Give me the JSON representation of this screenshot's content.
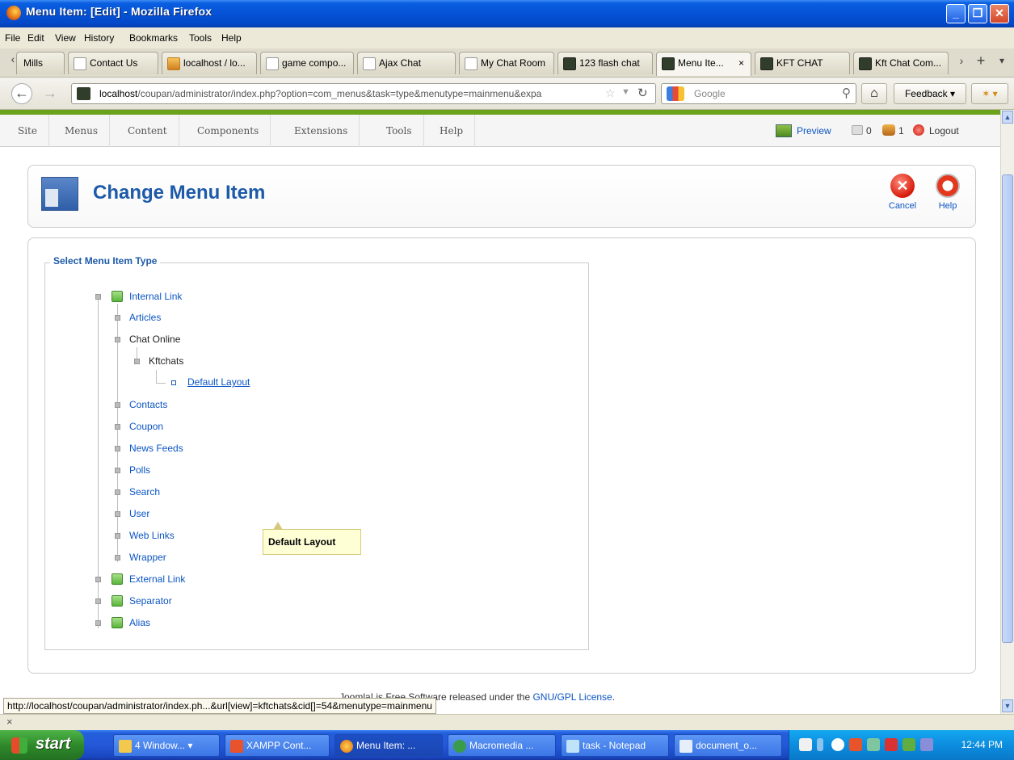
{
  "window": {
    "title": "Menu Item: [Edit] - Mozilla Firefox"
  },
  "menubar": [
    "File",
    "Edit",
    "View",
    "History",
    "Bookmarks",
    "Tools",
    "Help"
  ],
  "tabs": [
    {
      "label": "Mills",
      "icon": "page-icon"
    },
    {
      "label": "Contact Us",
      "icon": "page-icon"
    },
    {
      "label": "localhost / lo...",
      "icon": "phpmyadmin-icon"
    },
    {
      "label": "game compo...",
      "icon": "page-icon"
    },
    {
      "label": "Ajax Chat",
      "icon": "page-icon"
    },
    {
      "label": "My Chat Room",
      "icon": "page-icon"
    },
    {
      "label": "123 flash chat",
      "icon": "kft-icon"
    },
    {
      "label": "Menu Ite...",
      "icon": "kft-icon",
      "active": true
    },
    {
      "label": "KFT CHAT",
      "icon": "kft-icon"
    },
    {
      "label": "Kft Chat Com...",
      "icon": "kft-icon"
    }
  ],
  "nav": {
    "url_host": "localhost",
    "url_rest": "/coupan/administrator/index.php?option=com_menus&task=type&menutype=mainmenu&expa",
    "search_placeholder": "Google",
    "feedback": "Feedback"
  },
  "admin_menu": [
    "Site",
    "Menus",
    "Content",
    "Components",
    "Extensions",
    "Tools",
    "Help"
  ],
  "admin_right": {
    "preview": "Preview",
    "messages": "0",
    "users": "1",
    "logout": "Logout"
  },
  "toolbar": {
    "title": "Change Menu Item",
    "cancel": "Cancel",
    "help": "Help"
  },
  "panel": {
    "legend": "Select Menu Item Type"
  },
  "tree": {
    "internal_link": "Internal Link",
    "articles": "Articles",
    "chat_online": "Chat Online",
    "kftchats": "Kftchats",
    "default_layout": "Default Layout",
    "contacts": "Contacts",
    "coupon": "Coupon",
    "news_feeds": "News Feeds",
    "polls": "Polls",
    "search": "Search",
    "user": "User",
    "web_links": "Web Links",
    "wrapper": "Wrapper",
    "external_link": "External Link",
    "separator": "Separator",
    "alias": "Alias"
  },
  "tooltip": "Default Layout",
  "footer": {
    "pre": "Joomla! is Free Software released under the ",
    "link": "GNU/GPL License",
    "post": "."
  },
  "status_url": "http://localhost/coupan/administrator/index.ph...&url[view]=kftchats&cid[]=54&menutype=mainmenu",
  "closebar": "×",
  "taskbar": {
    "start": "start",
    "items": [
      "4 Window...",
      "XAMPP Cont...",
      "Menu Item: ...",
      "Macromedia ...",
      "task - Notepad",
      "document_o..."
    ],
    "clock": "12:44 PM"
  }
}
